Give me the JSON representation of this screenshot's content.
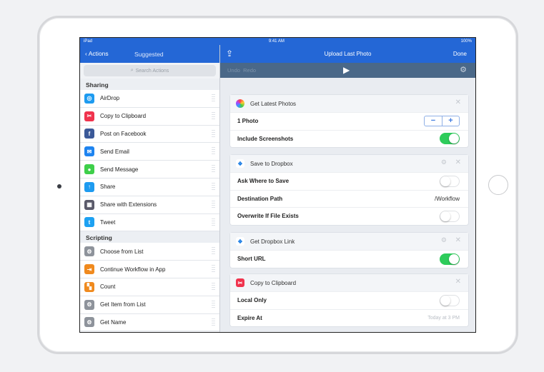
{
  "status": {
    "carrier": "iPad",
    "time": "9:41 AM",
    "battery": "100%"
  },
  "left": {
    "back_label": "Actions",
    "title": "Suggested",
    "search_placeholder": "Search Actions",
    "sections": [
      {
        "title": "Sharing",
        "items": [
          {
            "label": "AirDrop",
            "color": "#1e9bf0",
            "glyph": "◎"
          },
          {
            "label": "Copy to Clipboard",
            "color": "#f0334d",
            "glyph": "✂"
          },
          {
            "label": "Post on Facebook",
            "color": "#3b5998",
            "glyph": "f"
          },
          {
            "label": "Send Email",
            "color": "#1e84f0",
            "glyph": "✉"
          },
          {
            "label": "Send Message",
            "color": "#3ecf4a",
            "glyph": "●"
          },
          {
            "label": "Share",
            "color": "#1e9bf0",
            "glyph": "↑"
          },
          {
            "label": "Share with Extensions",
            "color": "#5a5a6a",
            "glyph": "▦"
          },
          {
            "label": "Tweet",
            "color": "#1da1f2",
            "glyph": "t"
          }
        ]
      },
      {
        "title": "Scripting",
        "items": [
          {
            "label": "Choose from List",
            "color": "#8e939b",
            "glyph": "⚙"
          },
          {
            "label": "Continue Workflow in App",
            "color": "#f08a1e",
            "glyph": "⇥"
          },
          {
            "label": "Count",
            "color": "#f08a1e",
            "glyph": "▚"
          },
          {
            "label": "Get Item from List",
            "color": "#8e939b",
            "glyph": "⚙"
          },
          {
            "label": "Get Name",
            "color": "#8e939b",
            "glyph": "⚙"
          }
        ]
      }
    ]
  },
  "right": {
    "title": "Upload Last Photo",
    "done_label": "Done",
    "undo_label": "Undo",
    "redo_label": "Redo",
    "cards": [
      {
        "title": "Get Latest Photos",
        "rows": [
          {
            "label": "1 Photo",
            "type": "stepper"
          },
          {
            "label": "Include Screenshots",
            "type": "toggle",
            "on": true
          }
        ]
      },
      {
        "title": "Save to Dropbox",
        "rows": [
          {
            "label": "Ask Where to Save",
            "type": "toggle",
            "on": false
          },
          {
            "label": "Destination Path",
            "type": "value",
            "value": "/Workflow"
          },
          {
            "label": "Overwrite If File Exists",
            "type": "toggle",
            "on": false
          }
        ]
      },
      {
        "title": "Get Dropbox Link",
        "rows": [
          {
            "label": "Short URL",
            "type": "toggle",
            "on": true
          }
        ]
      },
      {
        "title": "Copy to Clipboard",
        "rows": [
          {
            "label": "Local Only",
            "type": "toggle",
            "on": false
          },
          {
            "label": "Expire At",
            "type": "placeholder",
            "value": "Today at 3 PM"
          }
        ]
      }
    ]
  }
}
